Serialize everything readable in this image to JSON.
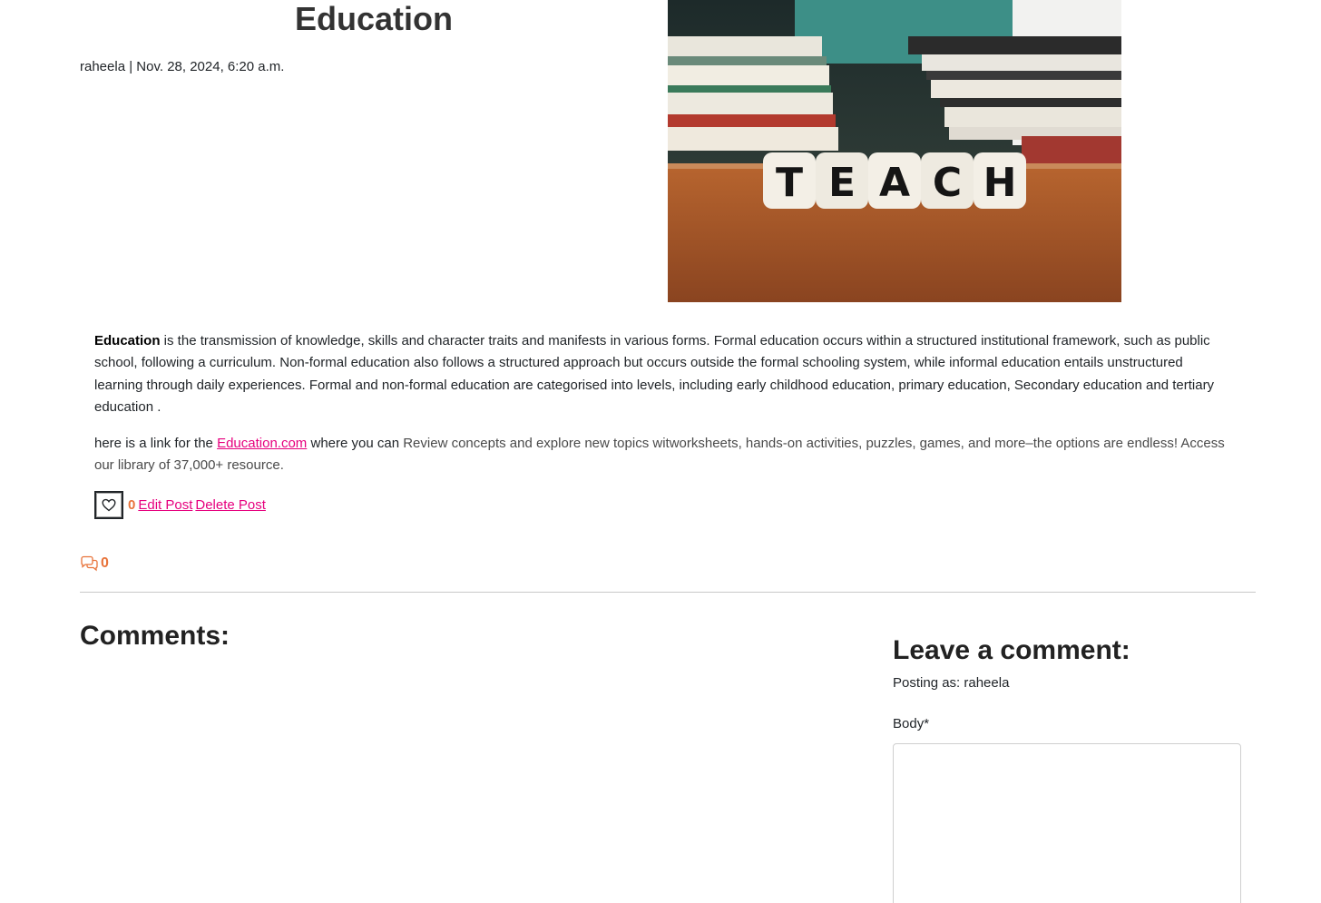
{
  "post": {
    "title": "Education",
    "author": "raheela",
    "separator": "|",
    "date": "Nov. 28, 2024, 6:20 a.m.",
    "image_text": "TEACH",
    "paragraph1_strong": "Education",
    "paragraph1_rest": " is the transmission of knowledge, skills and character traits and manifests in various forms. Formal education occurs within a structured institutional framework, such as public school, following a curriculum. Non-formal education also follows a structured approach but occurs outside the formal schooling system, while informal education entails unstructured learning through daily experiences. Formal and non-formal education are categorised into levels, including early childhood education, primary education, Secondary education  and tertiary education .",
    "paragraph2_intro": "here is a link for the ",
    "paragraph2_link": "Education.com",
    "paragraph2_mid": " where you can ",
    "paragraph2_rest": "Review concepts and explore new topics witworksheets, hands-on activities, puzzles, games, and more–the options are endless! Access our library of 37,000+ resource."
  },
  "actions": {
    "like_count": "0",
    "edit_label": "Edit Post",
    "delete_label": "Delete Post"
  },
  "comments": {
    "count": "0",
    "heading": "Comments:"
  },
  "comment_form": {
    "heading": "Leave a comment:",
    "posting_as": "Posting as: raheela",
    "body_label": "Body*",
    "body_value": ""
  },
  "colors": {
    "link": "#e6007e",
    "accent_orange": "#e8733a"
  }
}
